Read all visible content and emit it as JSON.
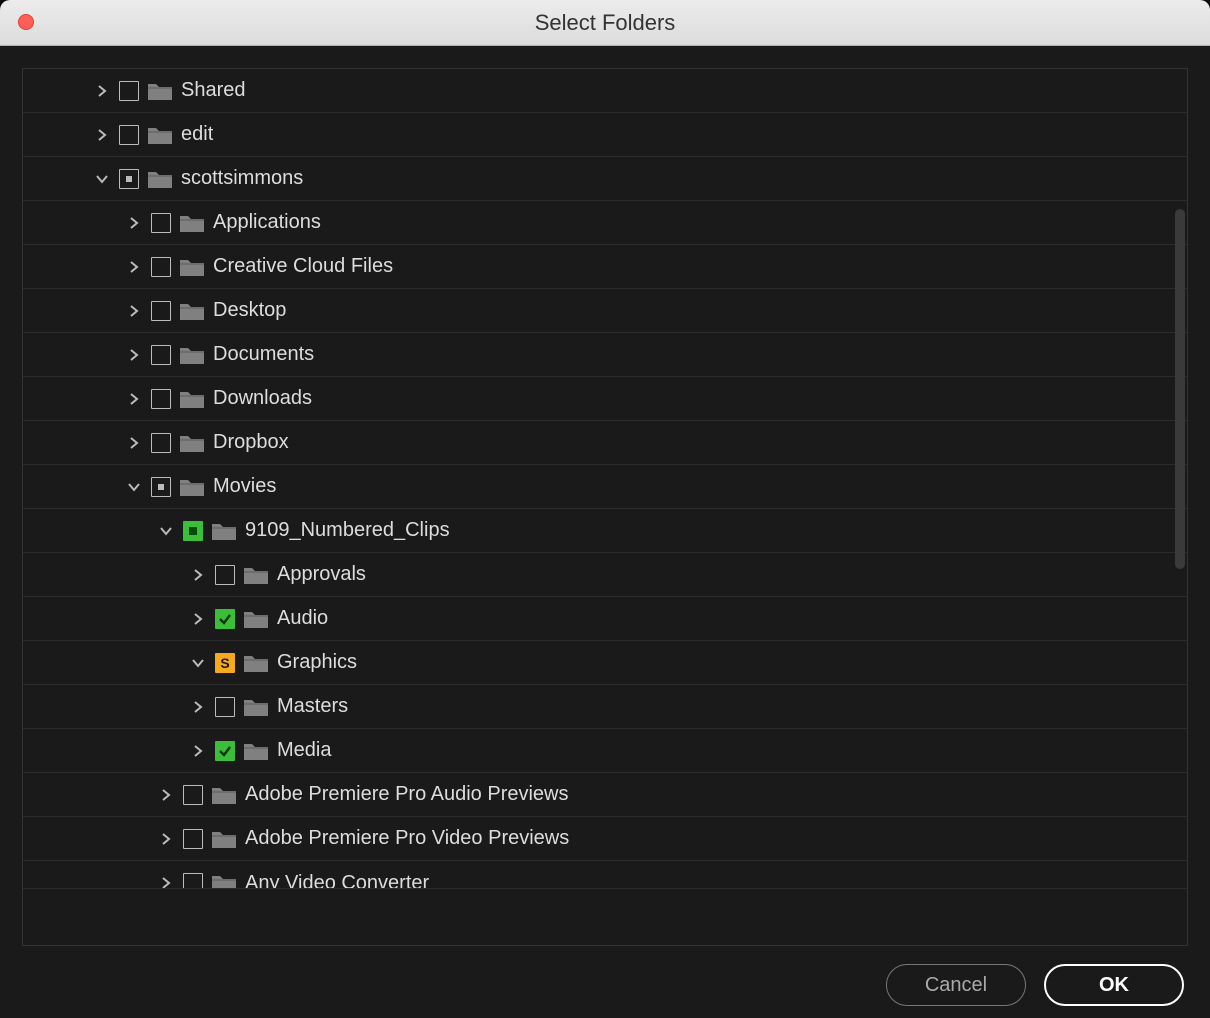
{
  "window": {
    "title": "Select Folders"
  },
  "tree": {
    "rows": [
      {
        "indent": 1,
        "disclosure": "right",
        "check": "empty",
        "label": "Shared"
      },
      {
        "indent": 1,
        "disclosure": "right",
        "check": "empty",
        "label": "edit"
      },
      {
        "indent": 1,
        "disclosure": "down",
        "check": "partial",
        "label": "scottsimmons"
      },
      {
        "indent": 2,
        "disclosure": "right",
        "check": "empty",
        "label": "Applications"
      },
      {
        "indent": 2,
        "disclosure": "right",
        "check": "empty",
        "label": "Creative Cloud Files"
      },
      {
        "indent": 2,
        "disclosure": "right",
        "check": "empty",
        "label": "Desktop"
      },
      {
        "indent": 2,
        "disclosure": "right",
        "check": "empty",
        "label": "Documents"
      },
      {
        "indent": 2,
        "disclosure": "right",
        "check": "empty",
        "label": "Downloads"
      },
      {
        "indent": 2,
        "disclosure": "right",
        "check": "empty",
        "label": "Dropbox"
      },
      {
        "indent": 2,
        "disclosure": "down",
        "check": "partial",
        "label": "Movies"
      },
      {
        "indent": 3,
        "disclosure": "down",
        "check": "greenpartial",
        "label": "9109_Numbered_Clips"
      },
      {
        "indent": 4,
        "disclosure": "right",
        "check": "empty",
        "label": "Approvals"
      },
      {
        "indent": 4,
        "disclosure": "right",
        "check": "checked",
        "label": "Audio"
      },
      {
        "indent": 4,
        "disclosure": "down",
        "check": "sbox",
        "label": "Graphics"
      },
      {
        "indent": 4,
        "disclosure": "right",
        "check": "empty",
        "label": "Masters"
      },
      {
        "indent": 4,
        "disclosure": "right",
        "check": "checked",
        "label": "Media"
      },
      {
        "indent": 3,
        "disclosure": "right",
        "check": "empty",
        "label": "Adobe Premiere Pro Audio Previews"
      },
      {
        "indent": 3,
        "disclosure": "right",
        "check": "empty",
        "label": "Adobe Premiere Pro Video Previews"
      },
      {
        "indent": 3,
        "disclosure": "right",
        "check": "empty",
        "label": "Any Video Converter",
        "cutoff": true
      }
    ]
  },
  "buttons": {
    "cancel": "Cancel",
    "ok": "OK"
  },
  "sbox_letter": "S"
}
